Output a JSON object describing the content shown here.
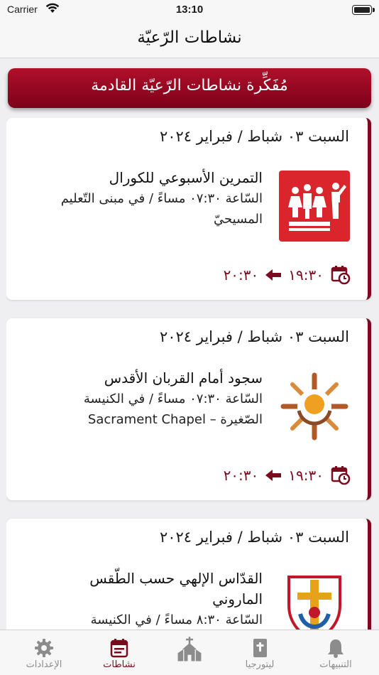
{
  "status_bar": {
    "carrier": "Carrier",
    "time": "13:10"
  },
  "nav": {
    "title": "نشاطات الرّعيّة"
  },
  "banner": {
    "label": "مُفَكِّرة نشاطات الرّعيّة القادمة"
  },
  "cards": [
    {
      "date": "السبت ٠٣ شباط / فبراير ٢٠٢٤",
      "title": "التمرين الأسبوعي للكورال",
      "details": [
        "السّاعة ٠٧:٣٠ مساءً / في مبنى التّعليم",
        "المسيحيّ"
      ],
      "icon": "choir-icon",
      "start": "١٩:٣٠",
      "end": "٢٠:٣٠"
    },
    {
      "date": "السبت ٠٣ شباط / فبراير ٢٠٢٤",
      "title": "سجود أمام القربان الأقدس",
      "details": [
        "السّاعة ٠٧:٣٠ مساءً / في الكنيسة",
        "الصّغيرة – Sacrament Chapel"
      ],
      "icon": "eucharist-icon",
      "start": "١٩:٣٠",
      "end": "٢٠:٣٠"
    },
    {
      "date": "السبت ٠٣ شباط / فبراير ٢٠٢٤",
      "title": "القدّاس الإلهي حسب الطّقس",
      "details": [
        "الماروني",
        "السّاعة ٨:٣٠ مساءً / في الكنيسة"
      ],
      "icon": "liturgy-cross-icon",
      "start": "",
      "end": ""
    }
  ],
  "tabs": [
    {
      "label": "الإعدادات",
      "icon": "gear-icon",
      "active": false
    },
    {
      "label": "نشاطات",
      "icon": "calendar-icon",
      "active": true
    },
    {
      "label": "",
      "icon": "church-icon",
      "active": false
    },
    {
      "label": "ليتورجيا",
      "icon": "bible-icon",
      "active": false
    },
    {
      "label": "التنبيهات",
      "icon": "bell-icon",
      "active": false
    }
  ],
  "colors": {
    "accent": "#7a0b1e",
    "banner_top": "#b0102a",
    "banner_bottom": "#7c0019",
    "inactive_tab": "#8c8c8c"
  }
}
